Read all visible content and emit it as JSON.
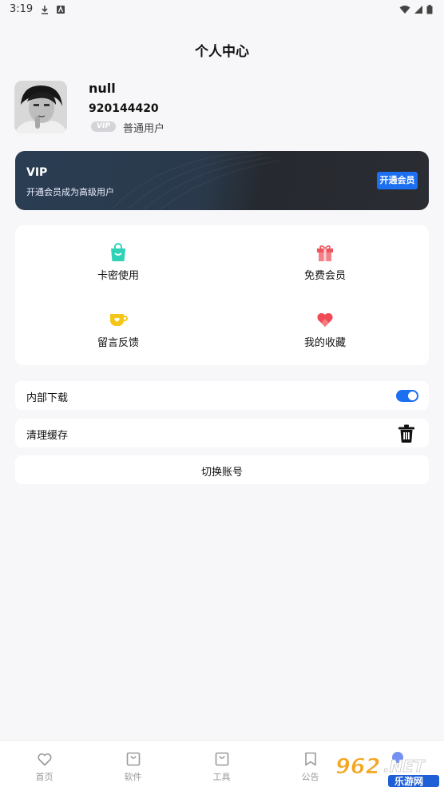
{
  "status_bar": {
    "time": "3:19"
  },
  "header": {
    "title": "个人中心"
  },
  "profile": {
    "name": "null",
    "id": "920144420",
    "vip_badge": "VIP",
    "level": "普通用户"
  },
  "vip_card": {
    "title": "VIP",
    "subtitle": "开通会员成为高级用户",
    "button_label": "开通会员"
  },
  "grid": {
    "items": [
      {
        "label": "卡密使用",
        "icon": "shopping-bag-icon",
        "color": "#2ed3b7"
      },
      {
        "label": "免费会员",
        "icon": "gift-icon",
        "color": "#f0545e"
      },
      {
        "label": "留言反馈",
        "icon": "coffee-cup-icon",
        "color": "#f5c518"
      },
      {
        "label": "我的收藏",
        "icon": "heart-icon",
        "color": "#ef4a55"
      }
    ]
  },
  "settings": {
    "download_label": "内部下载",
    "download_enabled": true,
    "cache_label": "清理缓存",
    "switch_account_label": "切换账号"
  },
  "tab_bar": {
    "tabs": [
      {
        "label": "首页",
        "icon": "heart-outline-icon"
      },
      {
        "label": "软件",
        "icon": "bag-outline-icon"
      },
      {
        "label": "工具",
        "icon": "bag-outline-icon"
      },
      {
        "label": "公告",
        "icon": "bookmark-outline-icon"
      }
    ]
  },
  "watermark": {
    "text": "962.NET",
    "sub": "乐游网"
  },
  "colors": {
    "accent": "#1d6ff2",
    "background": "#f7f7f9"
  }
}
